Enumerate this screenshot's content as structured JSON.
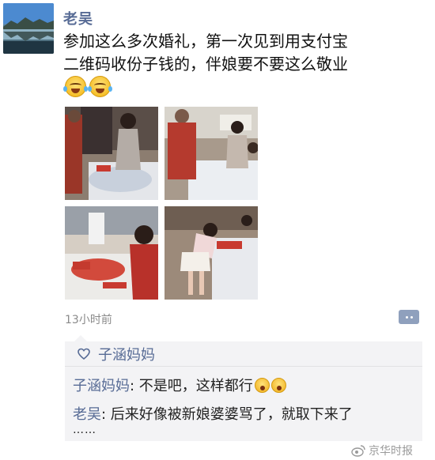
{
  "post": {
    "author": "老吴",
    "text_line1": "参加这么多次婚礼，第一次见到用支付宝",
    "text_line2": "二维码收份子钱的，伴娘要不要这么敬业",
    "emojis": [
      "laugh-cry-emoji",
      "laugh-cry-emoji"
    ],
    "photos": [
      "wedding-photo-1",
      "wedding-photo-2",
      "wedding-photo-3",
      "wedding-photo-4"
    ],
    "timestamp": "13小时前"
  },
  "likes": {
    "icon": "heart-icon",
    "names": "子涵妈妈"
  },
  "comments": [
    {
      "name": "子涵妈妈",
      "separator": ": ",
      "text": "不是吧，这样都行",
      "emojis": [
        "wow-emoji",
        "wow-emoji"
      ]
    },
    {
      "name": "老吴",
      "separator": ": ",
      "text": "后来好像被新娘婆婆骂了，就取下来了"
    },
    {
      "text": "……"
    }
  ],
  "watermark": {
    "icon": "weibo-icon",
    "text": "京华时报"
  },
  "colors": {
    "link": "#576b95",
    "comment_bg": "#f3f3f5",
    "timestamp": "#8a8a8a"
  }
}
